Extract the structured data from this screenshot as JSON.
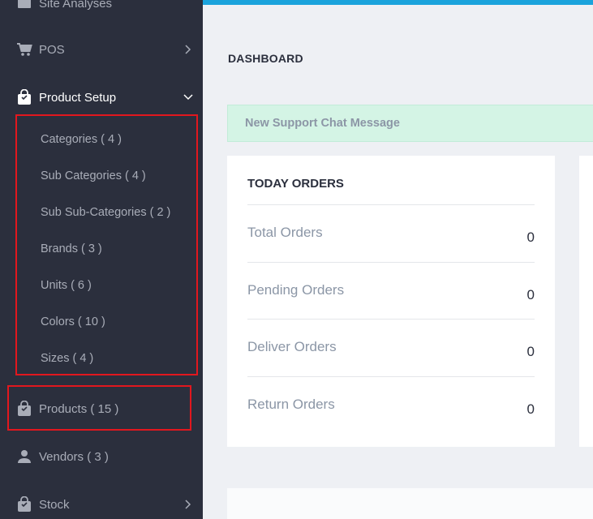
{
  "sidebar": {
    "items": [
      {
        "label": "Site Analyses",
        "icon": "chart-icon"
      },
      {
        "label": "POS",
        "icon": "cart-icon"
      },
      {
        "label": "Product Setup",
        "icon": "bag-icon"
      },
      {
        "label": "Products ( 15 )",
        "icon": "bag-icon"
      },
      {
        "label": "Vendors ( 3 )",
        "icon": "user-icon"
      },
      {
        "label": "Stock",
        "icon": "bag-icon"
      }
    ],
    "product_setup_sub": [
      "Categories ( 4 )",
      "Sub Categories ( 4 )",
      "Sub Sub-Categories ( 2 )",
      "Brands ( 3 )",
      "Units ( 6 )",
      "Colors ( 10 )",
      "Sizes ( 4 )"
    ]
  },
  "main": {
    "page_title": "DASHBOARD",
    "alert_text": "New Support Chat Message",
    "today_orders": {
      "title": "TODAY ORDERS",
      "rows": [
        {
          "label": "Total Orders",
          "value": "0"
        },
        {
          "label": "Pending Orders",
          "value": "0"
        },
        {
          "label": "Deliver Orders",
          "value": "0"
        },
        {
          "label": "Return Orders",
          "value": "0"
        }
      ]
    }
  },
  "colors": {
    "sidebar_bg": "#2b2f3d",
    "accent_topbar": "#1aa3dc",
    "highlight_box": "#e2171e",
    "alert_bg": "#d4f4e5"
  }
}
